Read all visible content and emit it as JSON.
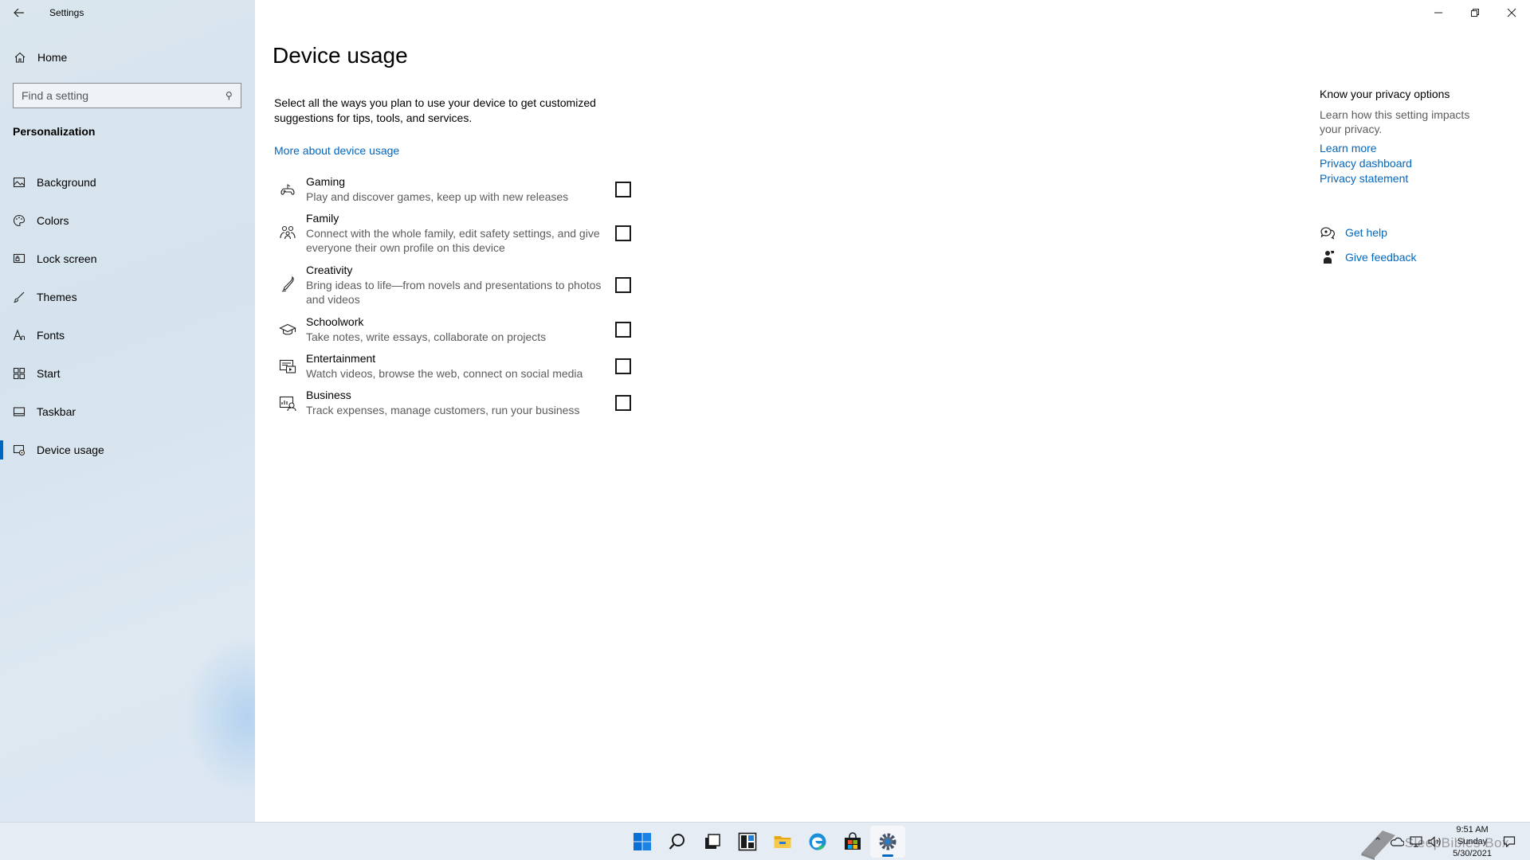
{
  "window": {
    "title": "Settings",
    "back_icon": "back-arrow-icon"
  },
  "sidebar": {
    "home_label": "Home",
    "search_placeholder": "Find a setting",
    "section_title": "Personalization",
    "items": [
      {
        "label": "Background",
        "icon": "picture-icon"
      },
      {
        "label": "Colors",
        "icon": "palette-icon"
      },
      {
        "label": "Lock screen",
        "icon": "lock-screen-icon"
      },
      {
        "label": "Themes",
        "icon": "brush-icon"
      },
      {
        "label": "Fonts",
        "icon": "font-icon"
      },
      {
        "label": "Start",
        "icon": "start-icon"
      },
      {
        "label": "Taskbar",
        "icon": "taskbar-icon"
      },
      {
        "label": "Device usage",
        "icon": "device-usage-icon",
        "active": true
      }
    ]
  },
  "main": {
    "title": "Device usage",
    "description": "Select all the ways you plan to use your device to get customized suggestions for tips, tools, and services.",
    "more_link": "More about device usage",
    "options": [
      {
        "title": "Gaming",
        "desc": "Play and discover games, keep up with new releases",
        "icon": "gaming-icon",
        "checked": false
      },
      {
        "title": "Family",
        "desc": "Connect with the whole family, edit safety settings, and give everyone their own profile on this device",
        "icon": "family-icon",
        "checked": false
      },
      {
        "title": "Creativity",
        "desc": "Bring ideas to life—from novels and presentations to photos and videos",
        "icon": "pen-icon",
        "checked": false
      },
      {
        "title": "Schoolwork",
        "desc": "Take notes, write essays, collaborate on projects",
        "icon": "graduation-cap-icon",
        "checked": false
      },
      {
        "title": "Entertainment",
        "desc": "Watch videos, browse the web, connect on social media",
        "icon": "media-icon",
        "checked": false
      },
      {
        "title": "Business",
        "desc": "Track expenses, manage customers, run your business",
        "icon": "business-icon",
        "checked": false
      }
    ]
  },
  "right": {
    "privacy_heading": "Know your privacy options",
    "privacy_sub": "Learn how this setting impacts your privacy.",
    "learn_more": "Learn more",
    "privacy_dashboard": "Privacy dashboard",
    "privacy_statement": "Privacy statement",
    "get_help": "Get help",
    "give_feedback": "Give feedback"
  },
  "taskbar": {
    "apps": [
      "start-icon",
      "search-icon",
      "task-view-icon",
      "widgets-icon",
      "file-explorer-icon",
      "edge-icon",
      "store-icon",
      "settings-icon"
    ],
    "clock_time": "9:51 AM",
    "clock_day": "Sunday",
    "clock_date": "5/30/2021",
    "watermark": "SleepBibles Box"
  },
  "colors": {
    "accent": "#0067c0",
    "sidebar_bg": "#d9e4ee",
    "taskbar_bg": "#e6ecf3"
  }
}
